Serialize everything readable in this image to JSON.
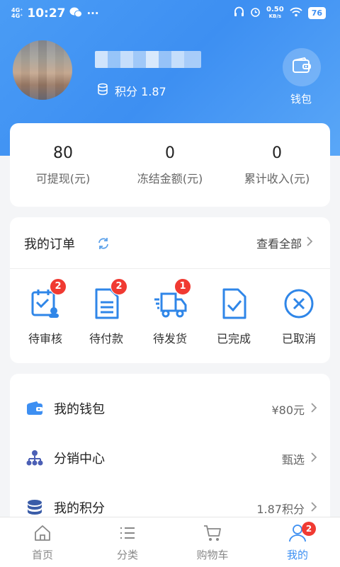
{
  "status_bar": {
    "network": "4G⁺HD\n4G⁺HD",
    "time": "10:27",
    "more": "···",
    "speed_value": "0.50",
    "speed_unit": "KB/s",
    "battery": "76"
  },
  "profile": {
    "points_label": "积分 1.87",
    "wallet_label": "钱包"
  },
  "stats": [
    {
      "value": "80",
      "label": "可提现(元)"
    },
    {
      "value": "0",
      "label": "冻结金额(元)"
    },
    {
      "value": "0",
      "label": "累计收入(元)"
    }
  ],
  "orders": {
    "title": "我的订单",
    "view_all": "查看全部",
    "items": [
      {
        "label": "待审核",
        "badge": "2",
        "icon": "review-icon"
      },
      {
        "label": "待付款",
        "badge": "2",
        "icon": "payment-doc-icon"
      },
      {
        "label": "待发货",
        "badge": "1",
        "icon": "truck-icon"
      },
      {
        "label": "已完成",
        "badge": "",
        "icon": "completed-check-icon"
      },
      {
        "label": "已取消",
        "badge": "",
        "icon": "cancel-circle-icon"
      }
    ]
  },
  "menu": [
    {
      "label": "我的钱包",
      "value": "¥80元",
      "icon": "wallet-icon"
    },
    {
      "label": "分销中心",
      "value": "甄选",
      "icon": "org-chart-icon"
    },
    {
      "label": "我的积分",
      "value": "1.87积分",
      "icon": "coins-stack-icon"
    }
  ],
  "tabbar": {
    "items": [
      {
        "label": "首页",
        "icon": "home-icon"
      },
      {
        "label": "分类",
        "icon": "list-icon"
      },
      {
        "label": "购物车",
        "icon": "cart-icon"
      },
      {
        "label": "我的",
        "icon": "user-icon",
        "badge": "2"
      }
    ],
    "active": "我的"
  },
  "colors": {
    "accent": "#3d8ff2",
    "badge": "#f03a32"
  }
}
